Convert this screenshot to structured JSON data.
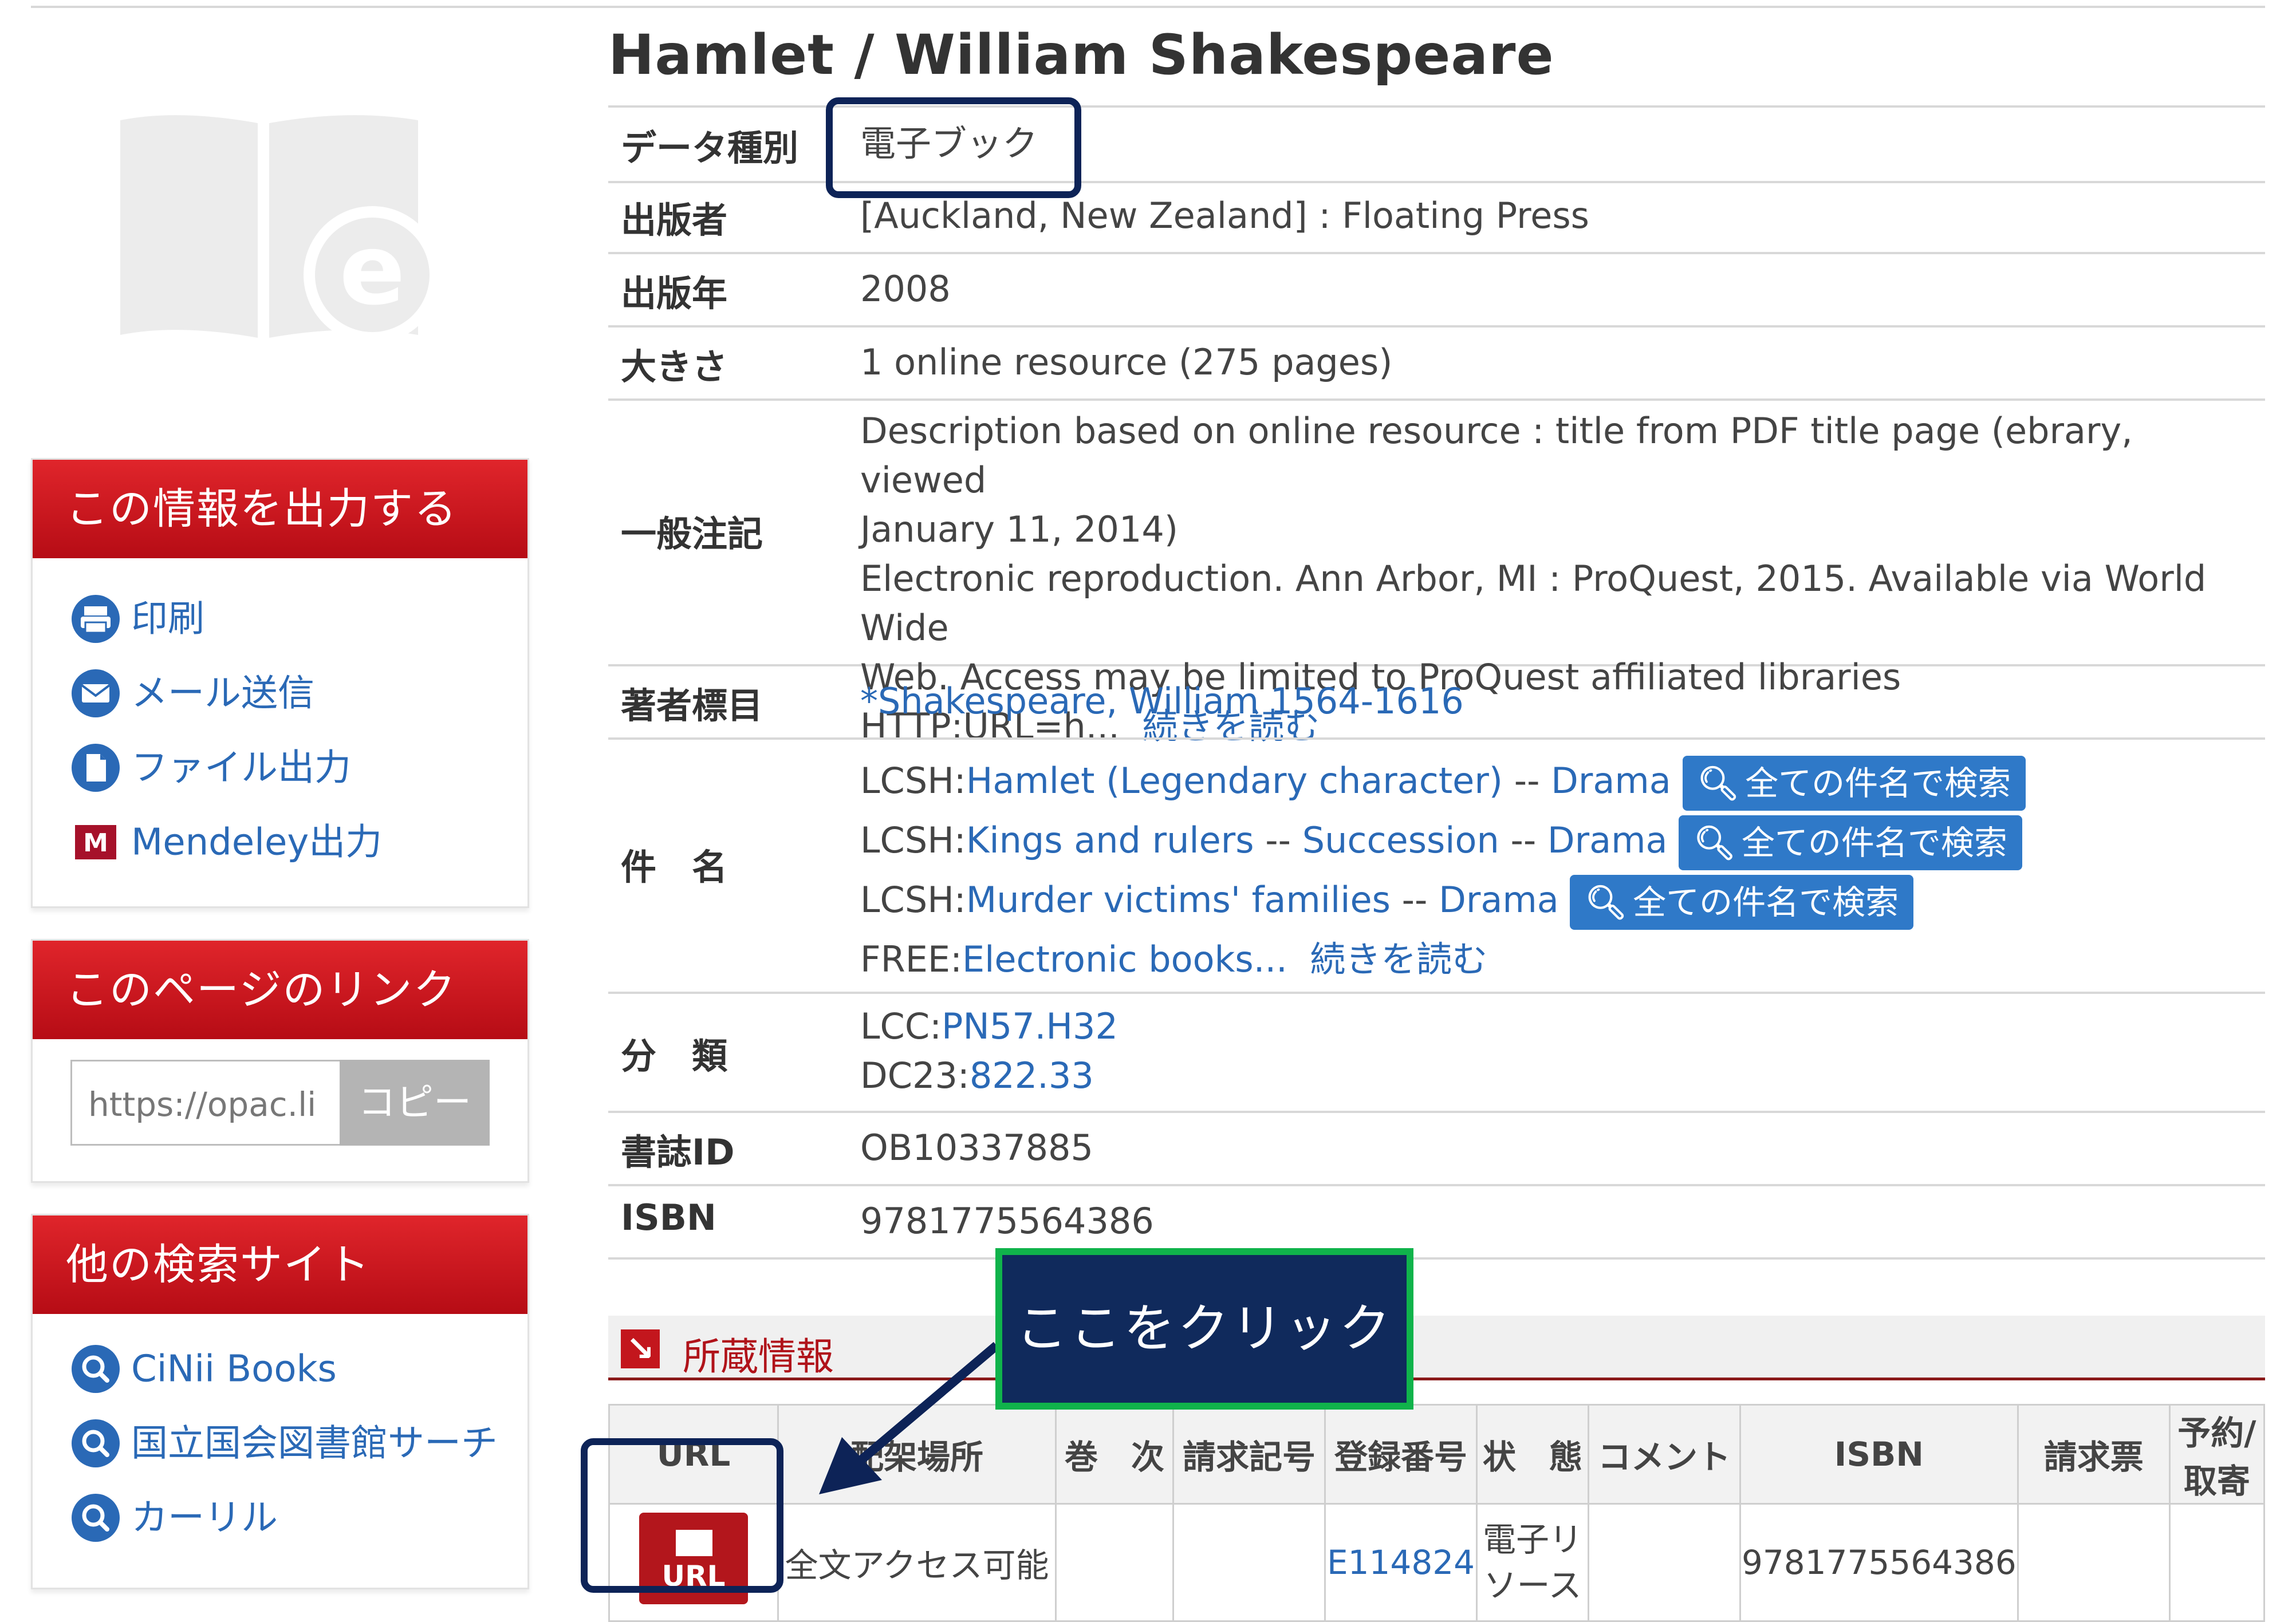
{
  "title": "Hamlet / William Shakespeare",
  "rows": {
    "type": {
      "label": "データ種別",
      "value": "電子ブック"
    },
    "publisher": {
      "label": "出版者",
      "value": "[Auckland, New Zealand] : Floating Press"
    },
    "year": {
      "label": "出版年",
      "value": "2008"
    },
    "size": {
      "label": "大きさ",
      "value": "1 online resource (275 pages)"
    },
    "notes": {
      "label": "一般注記",
      "line1": "Description based on online resource : title from PDF title page (ebrary, viewed",
      "line2": "January 11, 2014)",
      "line3": "Electronic reproduction. Ann Arbor, MI : ProQuest, 2015. Available via World Wide",
      "line4": "Web. Access may be limited to ProQuest affiliated libraries",
      "line5": "HTTP:URL=h...",
      "more": "続きを読む"
    },
    "author": {
      "label": "著者標目",
      "value": "*Shakespeare, William 1564-1616"
    },
    "subjects": {
      "label": "件　名",
      "items": [
        {
          "prefix": "LCSH:",
          "link": "Hamlet (Legendary character)",
          "sep": " -- ",
          "sub": "Drama",
          "button": "全ての件名で検索"
        },
        {
          "prefix": "LCSH:",
          "link": "Kings and rulers",
          "sep": " -- ",
          "link2": "Succession",
          "sep2": " -- ",
          "sub": "Drama",
          "button": "全ての件名で検索"
        },
        {
          "prefix": "LCSH:",
          "link": "Murder victims' families",
          "sep": " -- ",
          "sub": "Drama",
          "button": "全ての件名で検索"
        }
      ],
      "free_prefix": "FREE:",
      "free_link": "Electronic books...",
      "more": "続きを読む"
    },
    "classification": {
      "label": "分　類",
      "lcc_prefix": "LCC:",
      "lcc": "PN57.H32",
      "dc_prefix": "DC23:",
      "dc": "822.33"
    },
    "bibid": {
      "label": "書誌ID",
      "value": "OB10337885"
    },
    "isbn": {
      "label": "ISBN",
      "value": "9781775564386"
    }
  },
  "sidebar": {
    "output": {
      "title": "この情報を出力する",
      "items": [
        {
          "label": "印刷",
          "icon": "printer-icon"
        },
        {
          "label": "メール送信",
          "icon": "mail-icon"
        },
        {
          "label": "ファイル出力",
          "icon": "file-icon"
        },
        {
          "label": "Mendeley出力",
          "icon": "mendeley-icon"
        }
      ]
    },
    "link": {
      "title": "このページのリンク",
      "url": "https://opac.li",
      "copy": "コピー"
    },
    "other": {
      "title": "他の検索サイト",
      "items": [
        {
          "label": "CiNii Books",
          "icon": "search-icon"
        },
        {
          "label": "国立国会図書館サーチ",
          "icon": "search-icon"
        },
        {
          "label": "カーリル",
          "icon": "search-icon"
        }
      ]
    }
  },
  "holdings": {
    "title": "所蔵情報",
    "headers": [
      "URL",
      "配架場所",
      "巻　次",
      "請求記号",
      "登録番号",
      "状　態",
      "コメント",
      "ISBN",
      "請求票",
      "予約/取寄"
    ],
    "row": {
      "url_btn": "URL",
      "location": "全文アクセス可能",
      "volume": "",
      "call": "",
      "reg": "E114824",
      "status": "電子リソース",
      "comment": "",
      "isbn": "9781775564386",
      "slip": "",
      "reserve": ""
    }
  },
  "annotation": {
    "callout": "ここをクリック"
  },
  "colors": {
    "accent_red": "#c3161d",
    "link_blue": "#2a69b6",
    "button_blue": "#2f79c8",
    "annotation_navy": "#0d2357",
    "annotation_green": "#10b34b"
  }
}
